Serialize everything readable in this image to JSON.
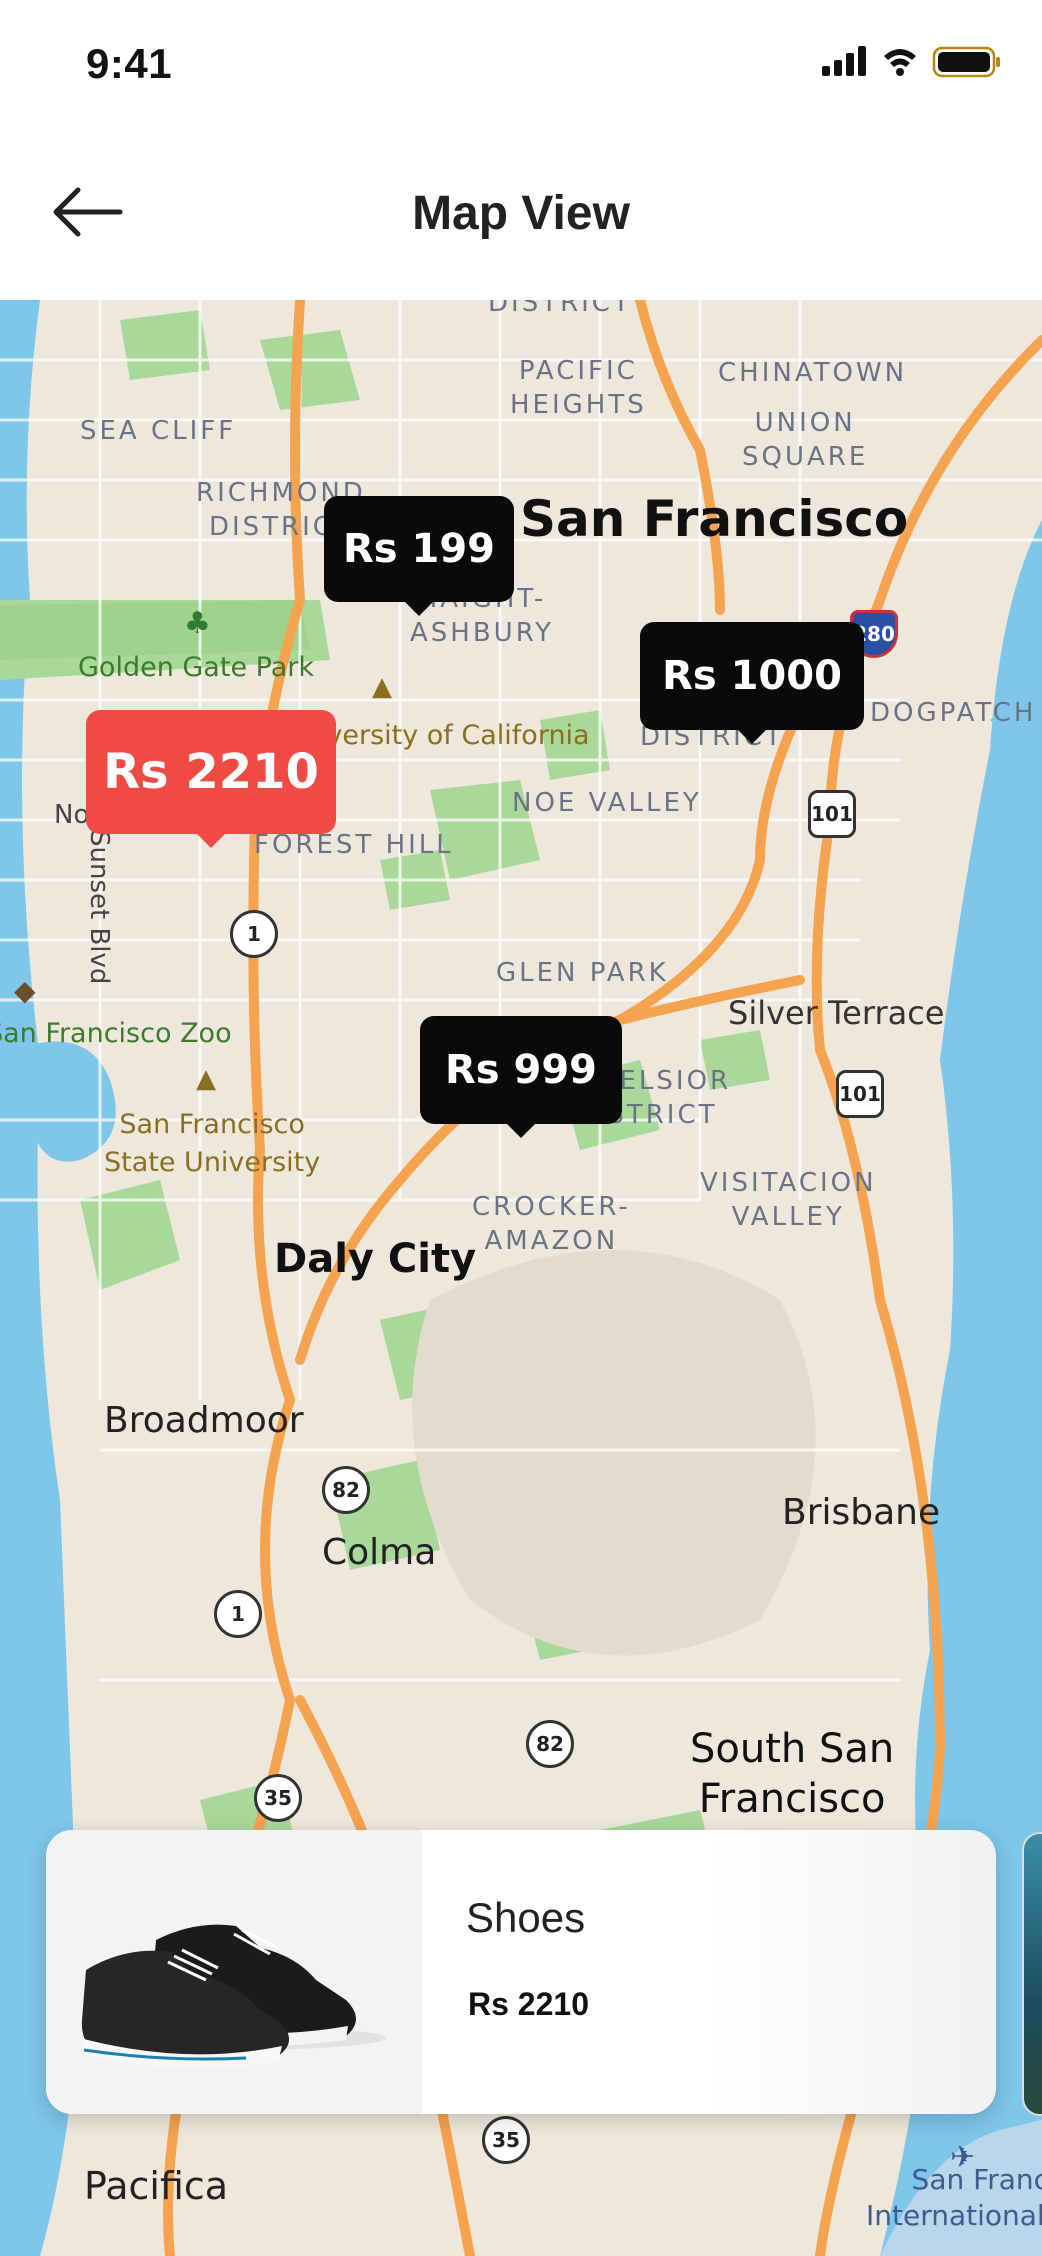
{
  "status_bar": {
    "time": "9:41"
  },
  "header": {
    "title": "Map View"
  },
  "map": {
    "labels": {
      "district_top": "DISTRICT",
      "pacific_heights": "PACIFIC\nHEIGHTS",
      "chinatown": "CHINATOWN",
      "union_square": "UNION\nSQUARE",
      "sea_cliff": "SEA CLIFF",
      "richmond": "RICHMOND\nDISTRICT",
      "san_francisco": "San Francisco",
      "haight": "HAIGHT-\nASHBURY",
      "golden_gate_park": "Golden Gate Park",
      "uni_california": "University of California",
      "dogpatch": "DOGPATCH",
      "mission": "DISTRICT",
      "noe_valley": "NOE VALLEY",
      "forest_hill": "FOREST HILL",
      "sunset_blvd": "Sunset Blvd",
      "north": "North",
      "glen_park": "GLEN PARK",
      "silver_terrace": "Silver Terrace",
      "sf_zoo": "San Francisco Zoo",
      "sf_state": "San Francisco\nState University",
      "excelsior": "EXCELSIOR\nDISTRICT",
      "visitacion": "VISITACION\nVALLEY",
      "crocker": "CROCKER-\nAMAZON",
      "daly_city": "Daly City",
      "broadmoor": "Broadmoor",
      "brisbane": "Brisbane",
      "colma": "Colma",
      "south_sf": "South San\nFrancisco",
      "pacifica": "Pacifica",
      "sf_intl": "San Francisco\nInternational Airport"
    },
    "shields": {
      "i280": "280",
      "us101_a": "101",
      "us101_b": "101",
      "r1_a": "1",
      "r1_b": "1",
      "r82_a": "82",
      "r82_b": "82",
      "r35_a": "35",
      "r35_b": "35"
    },
    "price_pins": [
      {
        "label": "Rs 199",
        "active": false
      },
      {
        "label": "Rs 1000",
        "active": false
      },
      {
        "label": "Rs 2210",
        "active": true
      },
      {
        "label": "Rs 999",
        "active": false
      }
    ],
    "colors": {
      "water": "#7ec6ea",
      "park": "#a9d99a",
      "land": "#eee8dc",
      "highway": "#f5a34e",
      "pin": "#0a0a0a",
      "pin_active": "#f04a45"
    }
  },
  "product_card": {
    "name": "Shoes",
    "price": "Rs 2210",
    "image_icon": "sneaker-icon"
  }
}
